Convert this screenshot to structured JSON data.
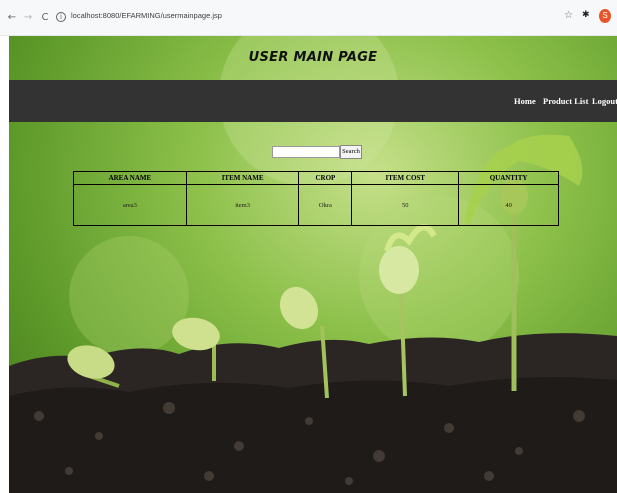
{
  "browser": {
    "url": "localhost:8080/EFARMING/usermainpage.jsp",
    "back_glyph": "←",
    "forward_glyph": "→",
    "reload_glyph": "C",
    "info_glyph": "i",
    "star_glyph": "☆",
    "extension_glyph": "✱",
    "profile_glyph": "S",
    "icons": [
      "back-arrow-icon",
      "forward-arrow-icon",
      "reload-icon",
      "site-info-icon",
      "bookmark-star-icon",
      "extensions-icon",
      "profile-avatar-icon"
    ]
  },
  "header": {
    "title": "USER MAIN PAGE"
  },
  "nav": {
    "home": "Home",
    "product_list": "Product List",
    "logout": "Logout"
  },
  "search": {
    "value": "",
    "button_label": "Search"
  },
  "table": {
    "columns": [
      "AREA NAME",
      "ITEM NAME",
      "CROP",
      "ITEM COST",
      "QUANTITY"
    ],
    "rows": [
      [
        "area3",
        "item3",
        "Okra",
        "50",
        "40"
      ]
    ]
  },
  "colors": {
    "navbar": "#333333",
    "nav_text": "#ffffff",
    "background_green": "#8cc04a",
    "soil": "#2a2522"
  }
}
